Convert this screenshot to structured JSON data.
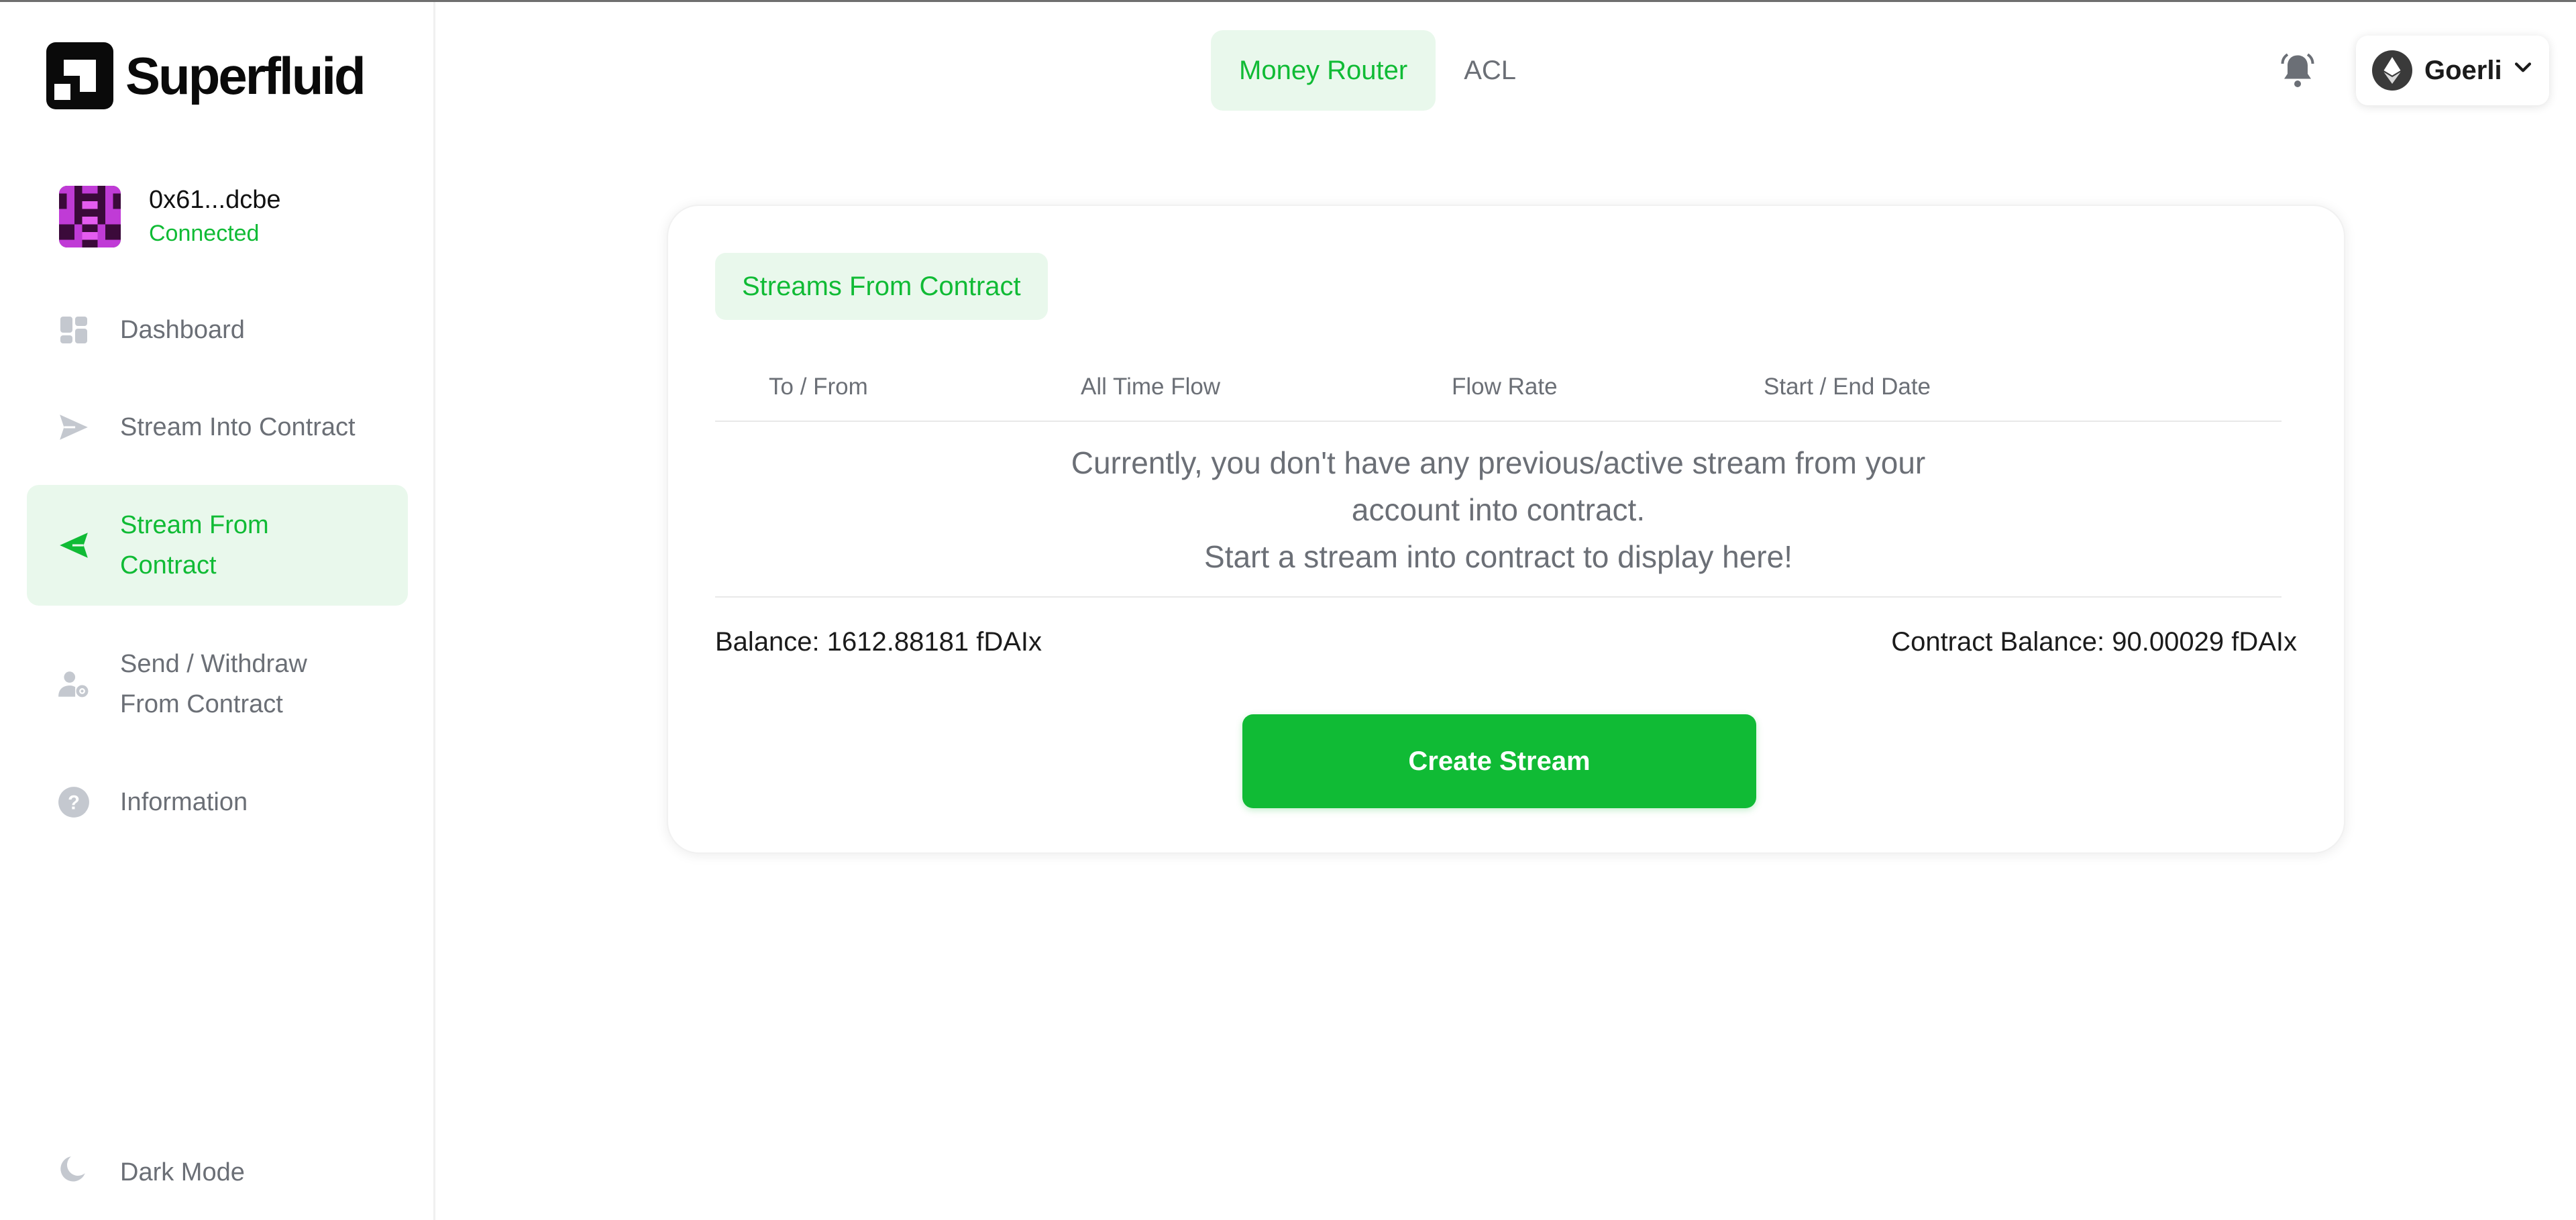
{
  "brand": {
    "name": "Superfluid"
  },
  "account": {
    "address": "0x61...dcbe",
    "status": "Connected"
  },
  "sidebar": {
    "items": [
      {
        "label": "Dashboard",
        "icon": "dashboard-icon"
      },
      {
        "label": "Stream Into Contract",
        "icon": "send-icon"
      },
      {
        "label": "Stream From Contract",
        "icon": "receive-icon",
        "active": true
      },
      {
        "label": "Send / Withdraw From Contract",
        "icon": "user-settings-icon"
      },
      {
        "label": "Information",
        "icon": "help-icon"
      }
    ],
    "dark_mode_label": "Dark Mode"
  },
  "top_tabs": [
    {
      "label": "Money Router",
      "active": true
    },
    {
      "label": "ACL",
      "active": false
    }
  ],
  "network": {
    "name": "Goerli",
    "icon": "ethereum-icon"
  },
  "card": {
    "tab_label": "Streams From Contract",
    "columns": [
      "To / From",
      "All Time Flow",
      "Flow Rate",
      "Start / End Date"
    ],
    "empty_message_line1": "Currently, you don't have any previous/active stream from your",
    "empty_message_line2": "account into contract.",
    "empty_message_line3": "Start a stream into contract to display here!",
    "balance": "Balance: 1612.88181 fDAIx",
    "contract_balance": "Contract Balance: 90.00029 fDAIx",
    "create_button": "Create Stream"
  },
  "colors": {
    "accent": "#10bb35",
    "accent_bg": "#e9f8ec",
    "muted_text": "#6b6f76"
  }
}
